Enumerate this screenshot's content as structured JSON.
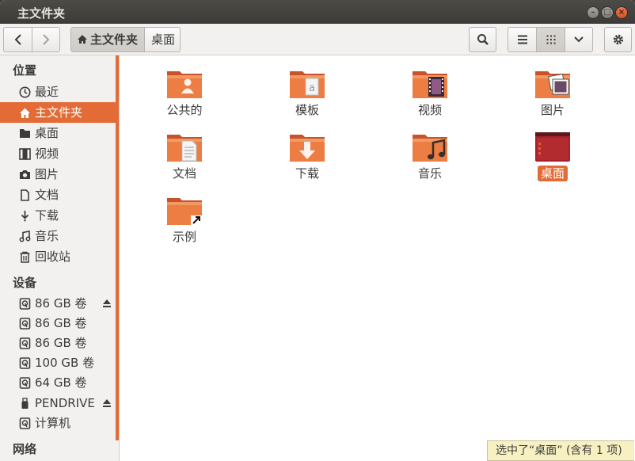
{
  "window": {
    "title": "主文件夹"
  },
  "breadcrumb": {
    "home": "主文件夹",
    "desktop": "桌面"
  },
  "sidebar": {
    "places_heading": "位置",
    "places": [
      {
        "label": "最近",
        "icon": "clock-icon"
      },
      {
        "label": "主文件夹",
        "icon": "home-icon",
        "selected": true
      },
      {
        "label": "桌面",
        "icon": "desktop-icon"
      },
      {
        "label": "视频",
        "icon": "film-icon"
      },
      {
        "label": "图片",
        "icon": "camera-icon"
      },
      {
        "label": "文档",
        "icon": "document-icon"
      },
      {
        "label": "下载",
        "icon": "download-icon"
      },
      {
        "label": "音乐",
        "icon": "music-icon"
      },
      {
        "label": "回收站",
        "icon": "trash-icon"
      }
    ],
    "devices_heading": "设备",
    "devices": [
      {
        "label": "86 GB 卷",
        "icon": "drive-icon",
        "eject": true
      },
      {
        "label": "86 GB 卷",
        "icon": "drive-icon"
      },
      {
        "label": "86 GB 卷",
        "icon": "drive-icon"
      },
      {
        "label": "100 GB 卷",
        "icon": "drive-icon"
      },
      {
        "label": "64 GB 卷",
        "icon": "drive-icon"
      },
      {
        "label": "PENDRIVE",
        "icon": "usb-icon",
        "eject": true
      },
      {
        "label": "计算机",
        "icon": "drive-icon"
      }
    ],
    "network_heading": "网络"
  },
  "files": [
    {
      "label": "公共的",
      "icon": "folder-public-icon"
    },
    {
      "label": "模板",
      "icon": "folder-templates-icon"
    },
    {
      "label": "视频",
      "icon": "folder-videos-icon"
    },
    {
      "label": "图片",
      "icon": "folder-pictures-icon"
    },
    {
      "label": "文档",
      "icon": "folder-documents-icon"
    },
    {
      "label": "下载",
      "icon": "folder-download-icon"
    },
    {
      "label": "音乐",
      "icon": "folder-music-icon"
    },
    {
      "label": "桌面",
      "icon": "folder-desktop-icon",
      "selected": true
    },
    {
      "label": "示例",
      "icon": "folder-examples-icon"
    }
  ],
  "status": {
    "text": "选中了“桌面” (含有 1 项)"
  },
  "colors": {
    "accent": "#e26b36",
    "titlebar": "#3c3b37",
    "folder": "#e8763c"
  }
}
